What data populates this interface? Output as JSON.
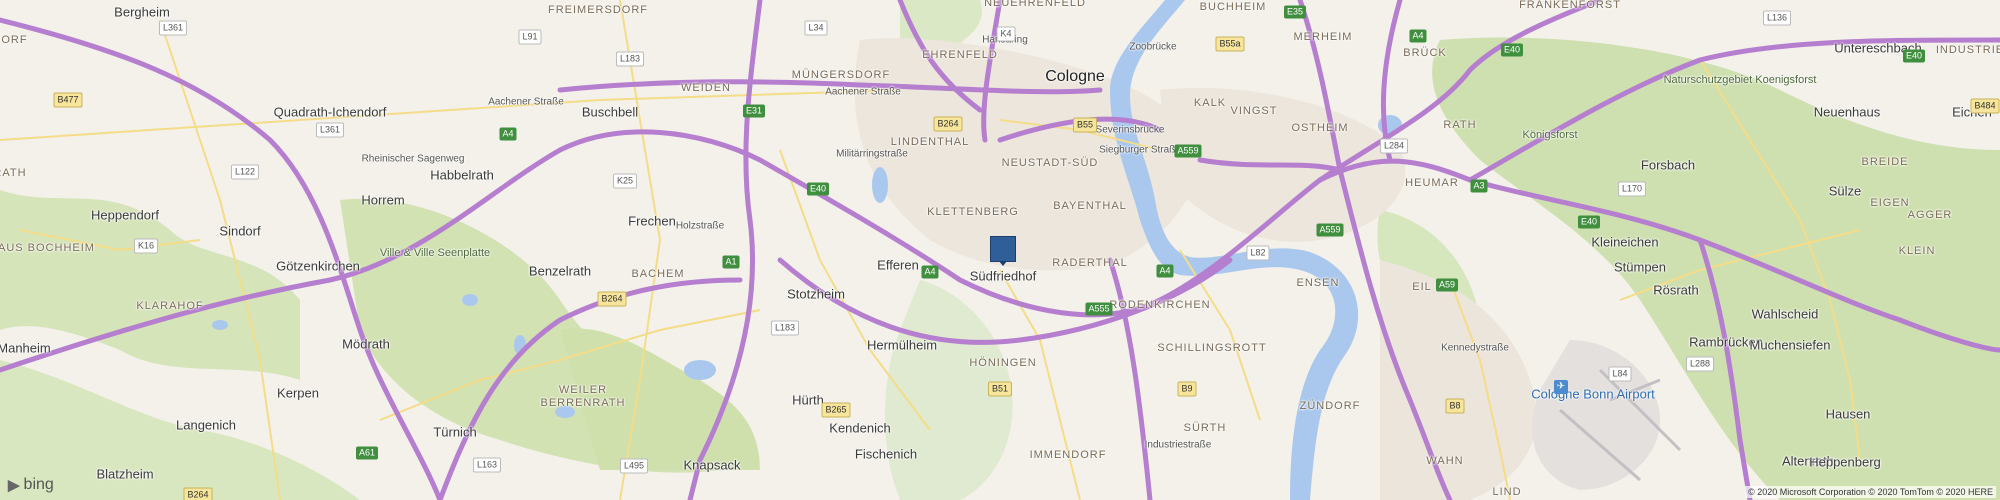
{
  "map": {
    "cities": [
      {
        "name": "Cologne"
      },
      {
        "name": "Bergheim"
      },
      {
        "name": "Quadrath-Ichendorf"
      },
      {
        "name": "Buschbell"
      },
      {
        "name": "Horrem"
      },
      {
        "name": "Habbelrath"
      },
      {
        "name": "Heppendorf"
      },
      {
        "name": "Sindorf"
      },
      {
        "name": "Götzenkirchen"
      },
      {
        "name": "Benzelrath"
      },
      {
        "name": "Frechen"
      },
      {
        "name": "Stotzheim"
      },
      {
        "name": "Efferen"
      },
      {
        "name": "Hermülheim"
      },
      {
        "name": "Manheim"
      },
      {
        "name": "Mödrath"
      },
      {
        "name": "Kerpen"
      },
      {
        "name": "Langenich"
      },
      {
        "name": "Türnich"
      },
      {
        "name": "Blatzheim"
      },
      {
        "name": "Knapsack"
      },
      {
        "name": "Hürth"
      },
      {
        "name": "Kendenich"
      },
      {
        "name": "Fischenich"
      },
      {
        "name": "Südfriedhof"
      },
      {
        "name": "Kleineichen"
      },
      {
        "name": "Forsbach"
      },
      {
        "name": "Sülze"
      },
      {
        "name": "Stümpen"
      },
      {
        "name": "Rösrath"
      },
      {
        "name": "Rambrücken"
      },
      {
        "name": "Wahlscheid"
      },
      {
        "name": "Muchensiefen"
      },
      {
        "name": "Hausen"
      },
      {
        "name": "Altenrath"
      },
      {
        "name": "Heppenberg"
      },
      {
        "name": "Neuenhaus"
      },
      {
        "name": "Untereschbach"
      },
      {
        "name": "Eichen"
      },
      {
        "name": "Cologne Bonn Airport"
      }
    ],
    "districts": [
      {
        "name": "FREIMERSDORF"
      },
      {
        "name": "NEUEHRENFELD"
      },
      {
        "name": "BUCHHEIM"
      },
      {
        "name": "FRANKENFORST"
      },
      {
        "name": "MERHEIM"
      },
      {
        "name": "BRÜCK"
      },
      {
        "name": "MÜNGERSDORF"
      },
      {
        "name": "EHRENFELD"
      },
      {
        "name": "KALK"
      },
      {
        "name": "VINGST"
      },
      {
        "name": "WEIDEN"
      },
      {
        "name": "LINDENTHAL"
      },
      {
        "name": "NEUSTADT-SÜD"
      },
      {
        "name": "OSTHEIM"
      },
      {
        "name": "RATH"
      },
      {
        "name": "HEUMAR"
      },
      {
        "name": "KLETTENBERG"
      },
      {
        "name": "BAYENTHAL"
      },
      {
        "name": "RADERTHAL"
      },
      {
        "name": "BACHEM"
      },
      {
        "name": "RODENKIRCHEN"
      },
      {
        "name": "ENSEN"
      },
      {
        "name": "EIL"
      },
      {
        "name": "KLARAHOF"
      },
      {
        "name": "HÖNINGEN"
      },
      {
        "name": "SCHILLINGSROTT"
      },
      {
        "name": "WEILER"
      },
      {
        "name": "BERRENRATH"
      },
      {
        "name": "SÜRTH"
      },
      {
        "name": "ZÜNDORF"
      },
      {
        "name": "IMMENDORF"
      },
      {
        "name": "WAHN"
      },
      {
        "name": "LIND"
      },
      {
        "name": "HAUS BOCHHEIM"
      },
      {
        "name": "BREIDE"
      },
      {
        "name": "EIGEN"
      },
      {
        "name": "KLEIN"
      },
      {
        "name": "AGGER"
      },
      {
        "name": "INDUSTRIE"
      },
      {
        "name": "DORF"
      },
      {
        "name": "RATH"
      }
    ],
    "parks": [
      {
        "name": "Naturschutzgebiet Koenigsforst"
      },
      {
        "name": "Königsforst"
      },
      {
        "name": "Ville & Ville Seenplatte"
      }
    ],
    "streets": [
      {
        "name": "Aachener Straße"
      },
      {
        "name": "Aachener Straße"
      },
      {
        "name": "Rheinischer Sagenweg"
      },
      {
        "name": "Militärringstraße"
      },
      {
        "name": "Holzstraße"
      },
      {
        "name": "Hansaring"
      },
      {
        "name": "Zoobrücke"
      },
      {
        "name": "Severinsbrücke"
      },
      {
        "name": "Siegburger Straße"
      },
      {
        "name": "Kennedystraße"
      },
      {
        "name": "Industriestraße"
      }
    ],
    "shields": [
      {
        "text": "L361",
        "kind": "local"
      },
      {
        "text": "L91",
        "kind": "local"
      },
      {
        "text": "L183",
        "kind": "local"
      },
      {
        "text": "L34",
        "kind": "local"
      },
      {
        "text": "K4",
        "kind": "local"
      },
      {
        "text": "E35",
        "kind": "auto"
      },
      {
        "text": "B55a",
        "kind": "fed"
      },
      {
        "text": "A4",
        "kind": "auto"
      },
      {
        "text": "E40",
        "kind": "auto"
      },
      {
        "text": "L136",
        "kind": "local"
      },
      {
        "text": "E40",
        "kind": "auto"
      },
      {
        "text": "B477",
        "kind": "fed"
      },
      {
        "text": "L361",
        "kind": "local"
      },
      {
        "text": "E31",
        "kind": "auto"
      },
      {
        "text": "B264",
        "kind": "fed"
      },
      {
        "text": "B55",
        "kind": "fed"
      },
      {
        "text": "A4",
        "kind": "auto"
      },
      {
        "text": "A559",
        "kind": "auto"
      },
      {
        "text": "L284",
        "kind": "local"
      },
      {
        "text": "L122",
        "kind": "local"
      },
      {
        "text": "K25",
        "kind": "local"
      },
      {
        "text": "E40",
        "kind": "auto"
      },
      {
        "text": "A3",
        "kind": "auto"
      },
      {
        "text": "L170",
        "kind": "local"
      },
      {
        "text": "K16",
        "kind": "local"
      },
      {
        "text": "A1",
        "kind": "auto"
      },
      {
        "text": "A4",
        "kind": "auto"
      },
      {
        "text": "A559",
        "kind": "auto"
      },
      {
        "text": "L82",
        "kind": "local"
      },
      {
        "text": "E40",
        "kind": "auto"
      },
      {
        "text": "B264",
        "kind": "fed"
      },
      {
        "text": "A555",
        "kind": "auto"
      },
      {
        "text": "A59",
        "kind": "auto"
      },
      {
        "text": "L183",
        "kind": "local"
      },
      {
        "text": "A4",
        "kind": "auto"
      },
      {
        "text": "B51",
        "kind": "fed"
      },
      {
        "text": "B9",
        "kind": "fed"
      },
      {
        "text": "L84",
        "kind": "local"
      },
      {
        "text": "L288",
        "kind": "local"
      },
      {
        "text": "B265",
        "kind": "fed"
      },
      {
        "text": "B8",
        "kind": "fed"
      },
      {
        "text": "A61",
        "kind": "auto"
      },
      {
        "text": "L163",
        "kind": "local"
      },
      {
        "text": "L495",
        "kind": "local"
      },
      {
        "text": "B264",
        "kind": "fed"
      },
      {
        "text": "B484",
        "kind": "fed"
      }
    ]
  },
  "branding": {
    "logo_text": "bing"
  },
  "copyright": "© 2020 Microsoft Corporation © 2020 TomTom © 2020 HERE",
  "colors": {
    "land": "#f3f1ea",
    "forest": "#cfe0b0",
    "water": "#aac8ee",
    "motorway": "#b77fd0",
    "road": "#f2d77b",
    "marker": "#2f5e99"
  }
}
